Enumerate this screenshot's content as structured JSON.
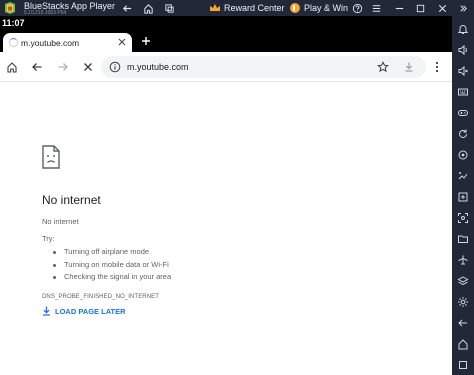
{
  "bluestacks": {
    "title": "BlueStacks App Player",
    "version": "5.10.210.1003 P64",
    "reward_label": "Reward Center",
    "playwin_label": "Play & Win",
    "accent": "#3ea8f5"
  },
  "android": {
    "time": "11:07"
  },
  "browser": {
    "tab_title": "m.youtube.com",
    "url": "m.youtube.com"
  },
  "error_page": {
    "title": "No internet",
    "subtitle": "No internet",
    "try_label": "Try:",
    "suggestions": [
      "Turning off airplane mode",
      "Turning on mobile data or Wi-Fi",
      "Checking the signal in your area"
    ],
    "error_code": "DNS_PROBE_FINISHED_NO_INTERNET",
    "action_label": "LOAD PAGE LATER",
    "link_color": "#1a73e8"
  },
  "sidebar_icons": [
    "bell-icon",
    "volume-icon",
    "volume-mute-icon",
    "keyboard-icon",
    "gamepad-icon",
    "rotate-icon",
    "location-icon",
    "macro-icon",
    "screenshot-icon",
    "camera-icon",
    "folder-icon",
    "airplane-icon",
    "layers-icon",
    "settings-icon",
    "back-icon",
    "home-icon",
    "recents-icon"
  ]
}
